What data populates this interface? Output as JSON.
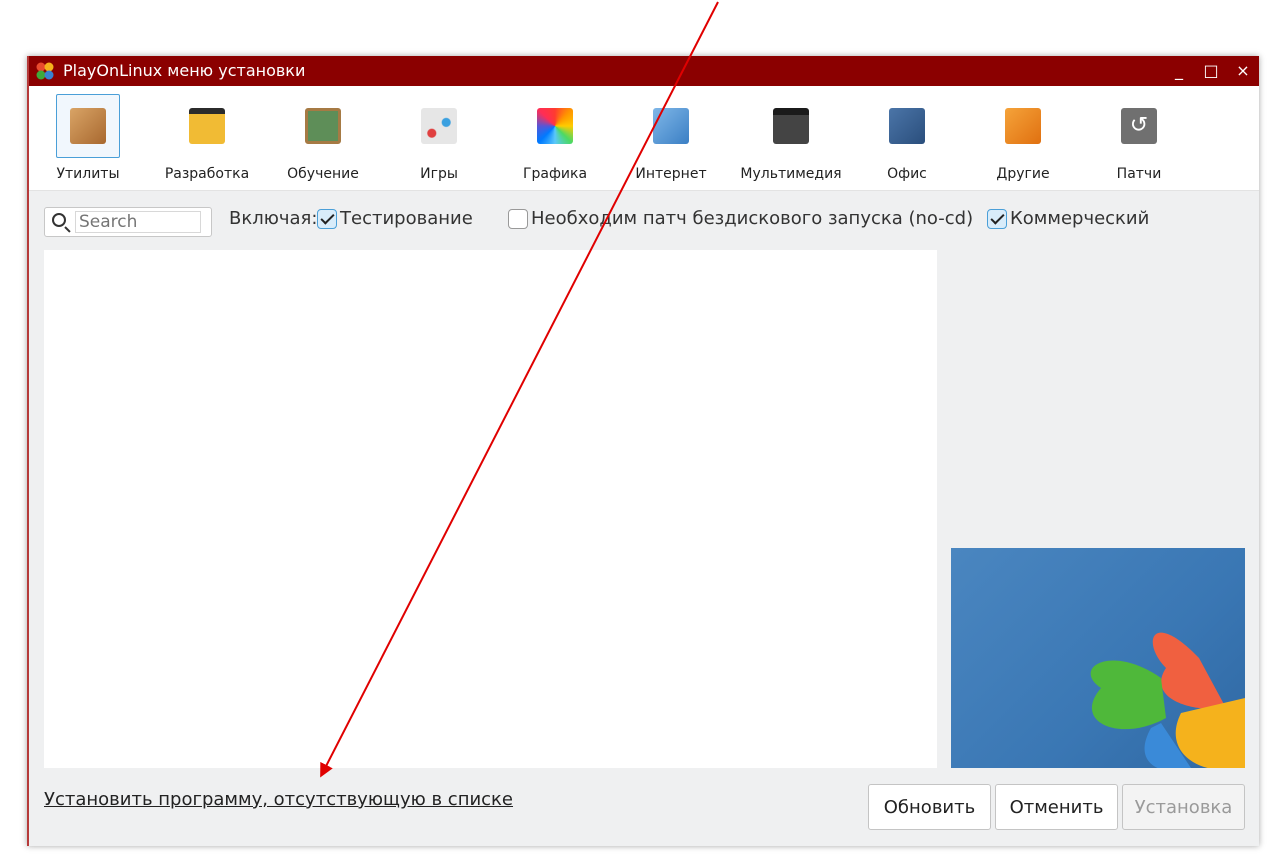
{
  "window": {
    "title": "PlayOnLinux меню установки",
    "controls": {
      "minimize": "_",
      "maximize": "□",
      "close": "×"
    }
  },
  "categories": [
    {
      "label": "Утилиты",
      "icon": "utilities-icon",
      "color": "#c9894b",
      "selected": true
    },
    {
      "label": "Разработка",
      "icon": "development-icon",
      "color": "#e8b23a",
      "selected": false
    },
    {
      "label": "Обучение",
      "icon": "education-icon",
      "color": "#5a8d5a",
      "selected": false
    },
    {
      "label": "Игры",
      "icon": "games-icon",
      "color": "#cfcfcf",
      "selected": false
    },
    {
      "label": "Графика",
      "icon": "graphics-icon",
      "color": "#d94b8f",
      "selected": false
    },
    {
      "label": "Интернет",
      "icon": "internet-icon",
      "color": "#4b90cf",
      "selected": false
    },
    {
      "label": "Мультимедия",
      "icon": "multimedia-icon",
      "color": "#3a3a3a",
      "selected": false
    },
    {
      "label": "Офис",
      "icon": "office-icon",
      "color": "#3a5e8c",
      "selected": false
    },
    {
      "label": "Другие",
      "icon": "other-icon",
      "color": "#f08c1e",
      "selected": false
    },
    {
      "label": "Патчи",
      "icon": "patches-icon",
      "color": "#6a6a6a",
      "selected": false
    }
  ],
  "filter": {
    "search_placeholder": "Search",
    "including_label": "Включая:",
    "checkboxes": [
      {
        "label": "Тестирование",
        "checked": true
      },
      {
        "label": "Необходим патч бездискового запуска (no-cd)",
        "checked": false
      },
      {
        "label": "Коммерческий",
        "checked": true
      }
    ]
  },
  "footer": {
    "install_unlisted_link": "Установить программу, отсутствующую в списке",
    "refresh_button": "Обновить",
    "cancel_button": "Отменить",
    "install_button": "Установка"
  },
  "colors": {
    "titlebar": "#8b0000",
    "annotation_arrow": "#e00000",
    "accent": "#4a9fd8"
  }
}
